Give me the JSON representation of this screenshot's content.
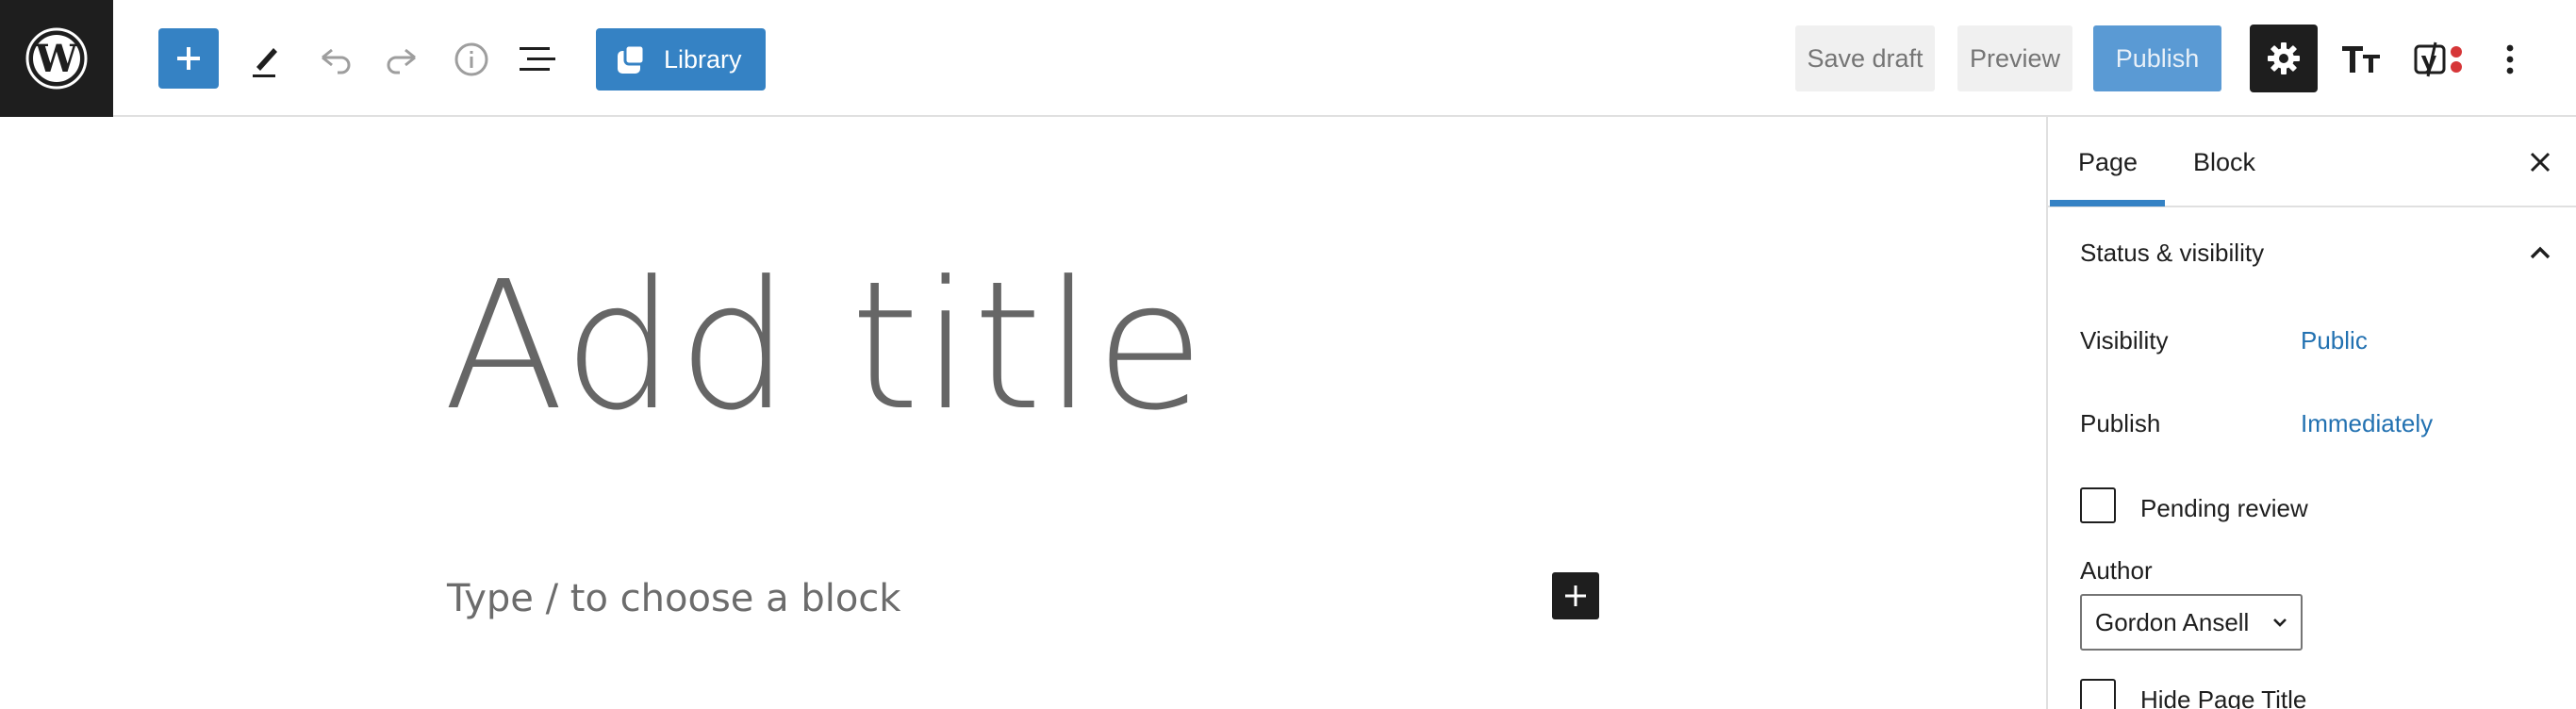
{
  "toolbar": {
    "logo_icon": "wordpress-logo",
    "inserter_icon": "plus-icon",
    "tools_icon": "pencil-icon",
    "undo_icon": "undo-icon",
    "redo_icon": "redo-icon",
    "details_icon": "info-icon",
    "list_view_icon": "list-view-icon",
    "library_label": "Library",
    "save_draft_label": "Save draft",
    "preview_label": "Preview",
    "publish_label": "Publish",
    "settings_icon": "gear-icon",
    "typography_icon": "typography-icon",
    "yoast_icon": "yoast-icon",
    "more_icon": "more-vertical-icon"
  },
  "editor": {
    "title_placeholder": "Add title",
    "block_placeholder": "Type / to choose a block"
  },
  "sidebar": {
    "tabs": [
      {
        "label": "Page",
        "active": true
      },
      {
        "label": "Block",
        "active": false
      }
    ],
    "panel": {
      "title": "Status & visibility",
      "visibility_label": "Visibility",
      "visibility_value": "Public",
      "publish_label": "Publish",
      "publish_value": "Immediately",
      "pending_review_label": "Pending review",
      "pending_review_checked": false,
      "author_label": "Author",
      "author_value": "Gordon Ansell",
      "hide_title_label": "Hide Page Title",
      "hide_title_checked": false
    }
  },
  "colors": {
    "accent": "#3582c4",
    "link": "#2271b1",
    "dark": "#1e1e1e",
    "yoast_dot": "#d63638"
  }
}
